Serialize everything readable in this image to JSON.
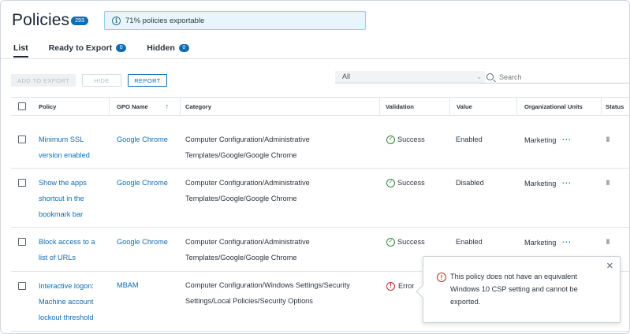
{
  "header": {
    "title": "Policies",
    "count": "293",
    "info_banner": "71% policies exportable"
  },
  "tabs": [
    {
      "label": "List",
      "badge": ""
    },
    {
      "label": "Ready to Export",
      "badge": "0"
    },
    {
      "label": "Hidden",
      "badge": "0"
    }
  ],
  "toolbar": {
    "add_to_export": "ADD TO EXPORT",
    "hide": "HIDE",
    "report": "REPORT",
    "filter_value": "All",
    "search_placeholder": "Search"
  },
  "columns": {
    "policy": "Policy",
    "gpo_name": "GPO Name",
    "category": "Category",
    "validation": "Validation",
    "value": "Value",
    "org_units": "Organizational Units",
    "status": "Status"
  },
  "rows": [
    {
      "policy_lines": [
        "Minimum SSL",
        "version enabled"
      ],
      "gpo": "Google Chrome",
      "category_lines": [
        "Computer Configuration/Administrative",
        "Templates/Google/Google Chrome"
      ],
      "validation": "Success",
      "value": "Enabled",
      "org_unit": "Marketing",
      "status": "ll"
    },
    {
      "policy_lines": [
        "Show the apps",
        "shortcut in the",
        "bookmark bar"
      ],
      "gpo": "Google Chrome",
      "category_lines": [
        "Computer Configuration/Administrative",
        "Templates/Google/Google Chrome"
      ],
      "validation": "Success",
      "value": "Disabled",
      "org_unit": "Marketing",
      "status": "ll"
    },
    {
      "policy_lines": [
        "Block access to a",
        "list of URLs"
      ],
      "gpo": "Google Chrome",
      "category_lines": [
        "Computer Configuration/Administrative",
        "Templates/Google/Google Chrome"
      ],
      "validation": "Success",
      "value": "Enabled",
      "org_unit": "Marketing",
      "status": "ll"
    },
    {
      "policy_lines": [
        "Interactive logon:",
        "Machine account",
        "lockout threshold"
      ],
      "gpo": "MBAM",
      "category_lines": [
        "Computer Configuration/Windows Settings/Security",
        "Settings/Local Policies/Security Options"
      ],
      "validation": "Error",
      "value": "",
      "org_unit": "",
      "status": ""
    }
  ],
  "tooltip": {
    "lines": [
      "This policy does not have an equivalent",
      "Windows 10 CSP setting and cannot be",
      "exported."
    ]
  },
  "colors": {
    "accent": "#0f6db3",
    "success": "#2e8b3b",
    "error": "#c62b2b",
    "banner_bg": "#e8f5fa"
  }
}
